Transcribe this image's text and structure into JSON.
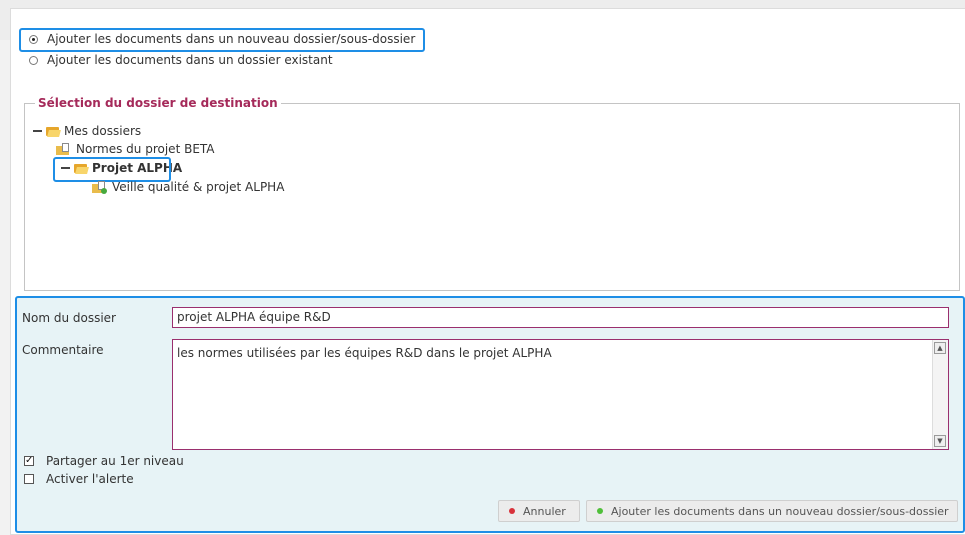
{
  "options": {
    "new_folder_label": "Ajouter les documents dans un nouveau dossier/sous-dossier",
    "existing_folder_label": "Ajouter les documents dans un dossier existant",
    "selected": "new_folder"
  },
  "destination": {
    "legend": "Sélection du dossier de destination",
    "tree": [
      {
        "label": "Mes dossiers"
      },
      {
        "label": "Normes du projet BETA"
      },
      {
        "label": "Projet ALPHA",
        "selected": true
      },
      {
        "label": "Veille qualité & projet ALPHA"
      }
    ]
  },
  "form": {
    "folder_name_label": "Nom du dossier",
    "folder_name_value": "projet ALPHA équipe R&D",
    "comment_label": "Commentaire",
    "comment_value": "les normes utilisées par les équipes R&D dans le projet ALPHA",
    "share_label": "Partager au 1er niveau",
    "share_checked": true,
    "alert_label": "Activer l'alerte",
    "alert_checked": false
  },
  "buttons": {
    "cancel_label": "Annuler",
    "submit_label": "Ajouter les documents dans un nouveau dossier/sous-dossier"
  },
  "colors": {
    "highlight": "#1e8ee6",
    "legend": "#a52a5a",
    "field_border": "#9a2f6e",
    "cancel_dot": "#d8313a",
    "submit_dot": "#4fbf3a"
  }
}
